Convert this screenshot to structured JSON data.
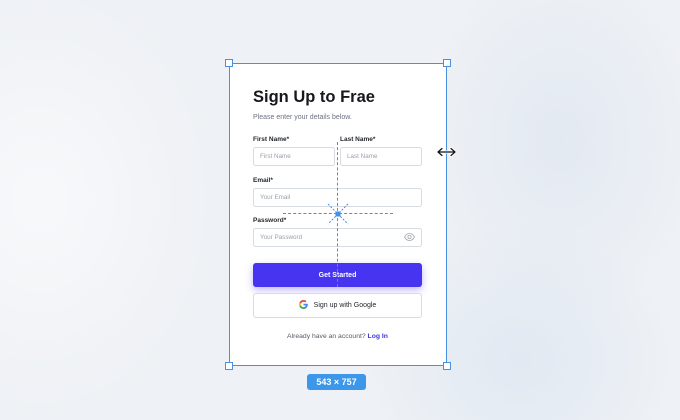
{
  "form": {
    "title": "Sign Up to Frae",
    "subtitle": "Please enter your details below.",
    "first_name": {
      "label": "First Name*",
      "placeholder": "First Name"
    },
    "last_name": {
      "label": "Last Name*",
      "placeholder": "Last Name"
    },
    "email": {
      "label": "Email*",
      "placeholder": "Your Email"
    },
    "password": {
      "label": "Password*",
      "placeholder": "Your Password"
    },
    "submit_label": "Get Started",
    "google_label": "Sign up with Google",
    "footer_text": "Already have an account?",
    "login_label": "Log In"
  },
  "canvas": {
    "size_label": "543 × 757"
  },
  "colors": {
    "accent": "#4634f0",
    "selection": "#4a90e2",
    "background": "#eef1f5"
  },
  "icons": [
    "eye-icon",
    "google-icon",
    "resize-horizontal-icon",
    "crosshair-icon"
  ]
}
